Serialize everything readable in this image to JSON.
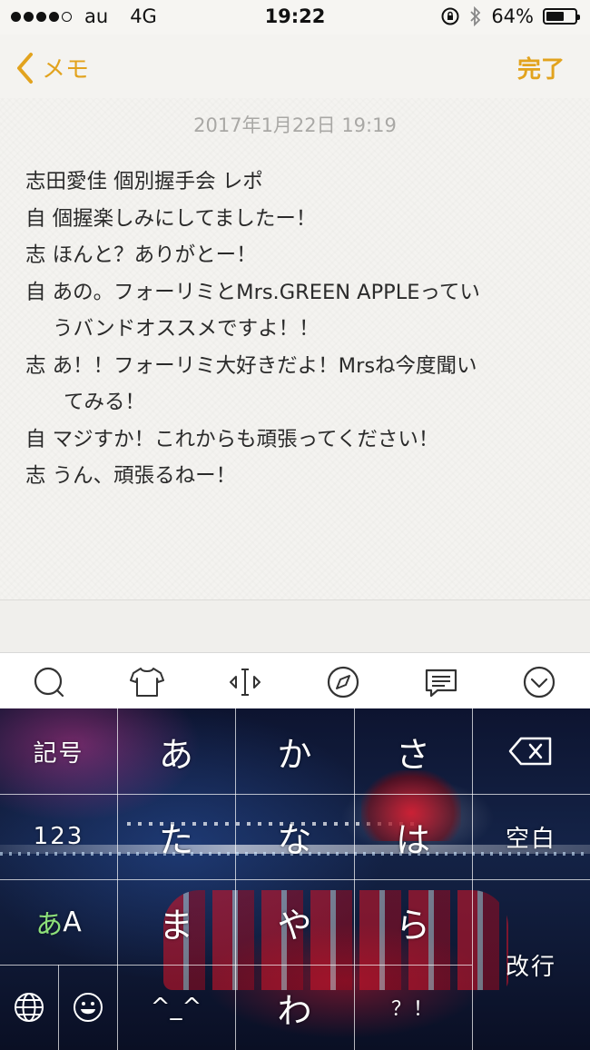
{
  "status_bar": {
    "carrier": "au",
    "network": "4G",
    "time": "19:22",
    "battery_percent": "64%",
    "battery_level": 0.64,
    "signal_bars_filled": 4,
    "signal_bars_total": 5
  },
  "nav": {
    "back_label": "メモ",
    "done_label": "完了",
    "accent_color": "#e2a31e"
  },
  "note": {
    "date": "2017年1月22日 19:19",
    "lines": [
      "志田愛佳 個別握手会 レポ",
      "自  個握楽しみにしてましたー！",
      "志  ほんと？ありがとー！",
      "自  あの。フォーリミとMrs.GREEN APPLEってい",
      "うバンドオススメですよ！！",
      "志   あ！！フォーリミ大好きだよ！Mrsね今度聞い",
      "てみる！",
      "自   マジすか！これからも頑張ってください！",
      "志   うん、頑張るねー！"
    ]
  },
  "toolbar": {
    "icons": [
      "search-bubble-icon",
      "shirt-icon",
      "cursor-move-icon",
      "compass-icon",
      "message-icon",
      "chevron-down-circle-icon"
    ]
  },
  "keyboard": {
    "keys": {
      "symbols": "記号",
      "a": "あ",
      "ka": "か",
      "sa": "さ",
      "num": "123",
      "ta": "た",
      "na": "な",
      "ha": "は",
      "space": "空白",
      "mode_kana": "あ",
      "mode_alpha": "A",
      "ma": "ま",
      "ya": "や",
      "ra": "ら",
      "return": "改行",
      "emoticon": "^_^",
      "wa": "わ",
      "punct": "？！"
    }
  }
}
